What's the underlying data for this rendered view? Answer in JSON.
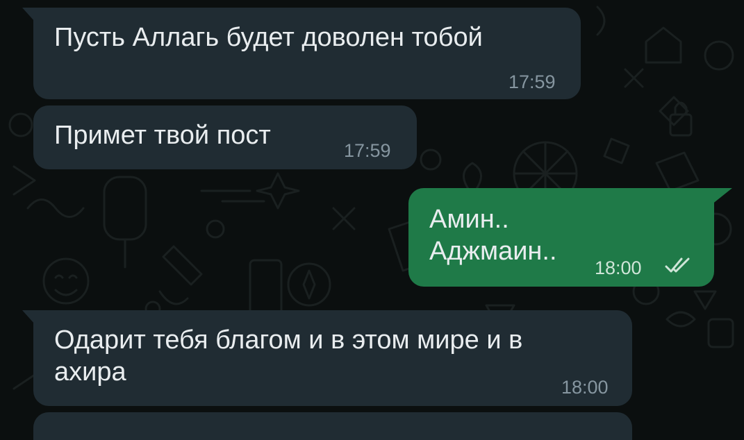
{
  "messages": [
    {
      "direction": "incoming",
      "text": "Пусть Аллагь будет доволен тобой",
      "time": "17:59"
    },
    {
      "direction": "incoming",
      "text": "Примет твой пост",
      "time": "17:59"
    },
    {
      "direction": "outgoing",
      "text": "Амин..\nАджмаин..",
      "time": "18:00",
      "status": "read",
      "status_icon": "double-check-icon"
    },
    {
      "direction": "incoming",
      "text": "Одарит тебя благом и в этом мире и в\nахира",
      "time": "18:00"
    }
  ],
  "colors": {
    "background": "#0b0f0f",
    "incoming_bubble": "#202c33",
    "outgoing_bubble": "#1f7a48",
    "text": "#e9edef",
    "timestamp": "#8696a0"
  }
}
